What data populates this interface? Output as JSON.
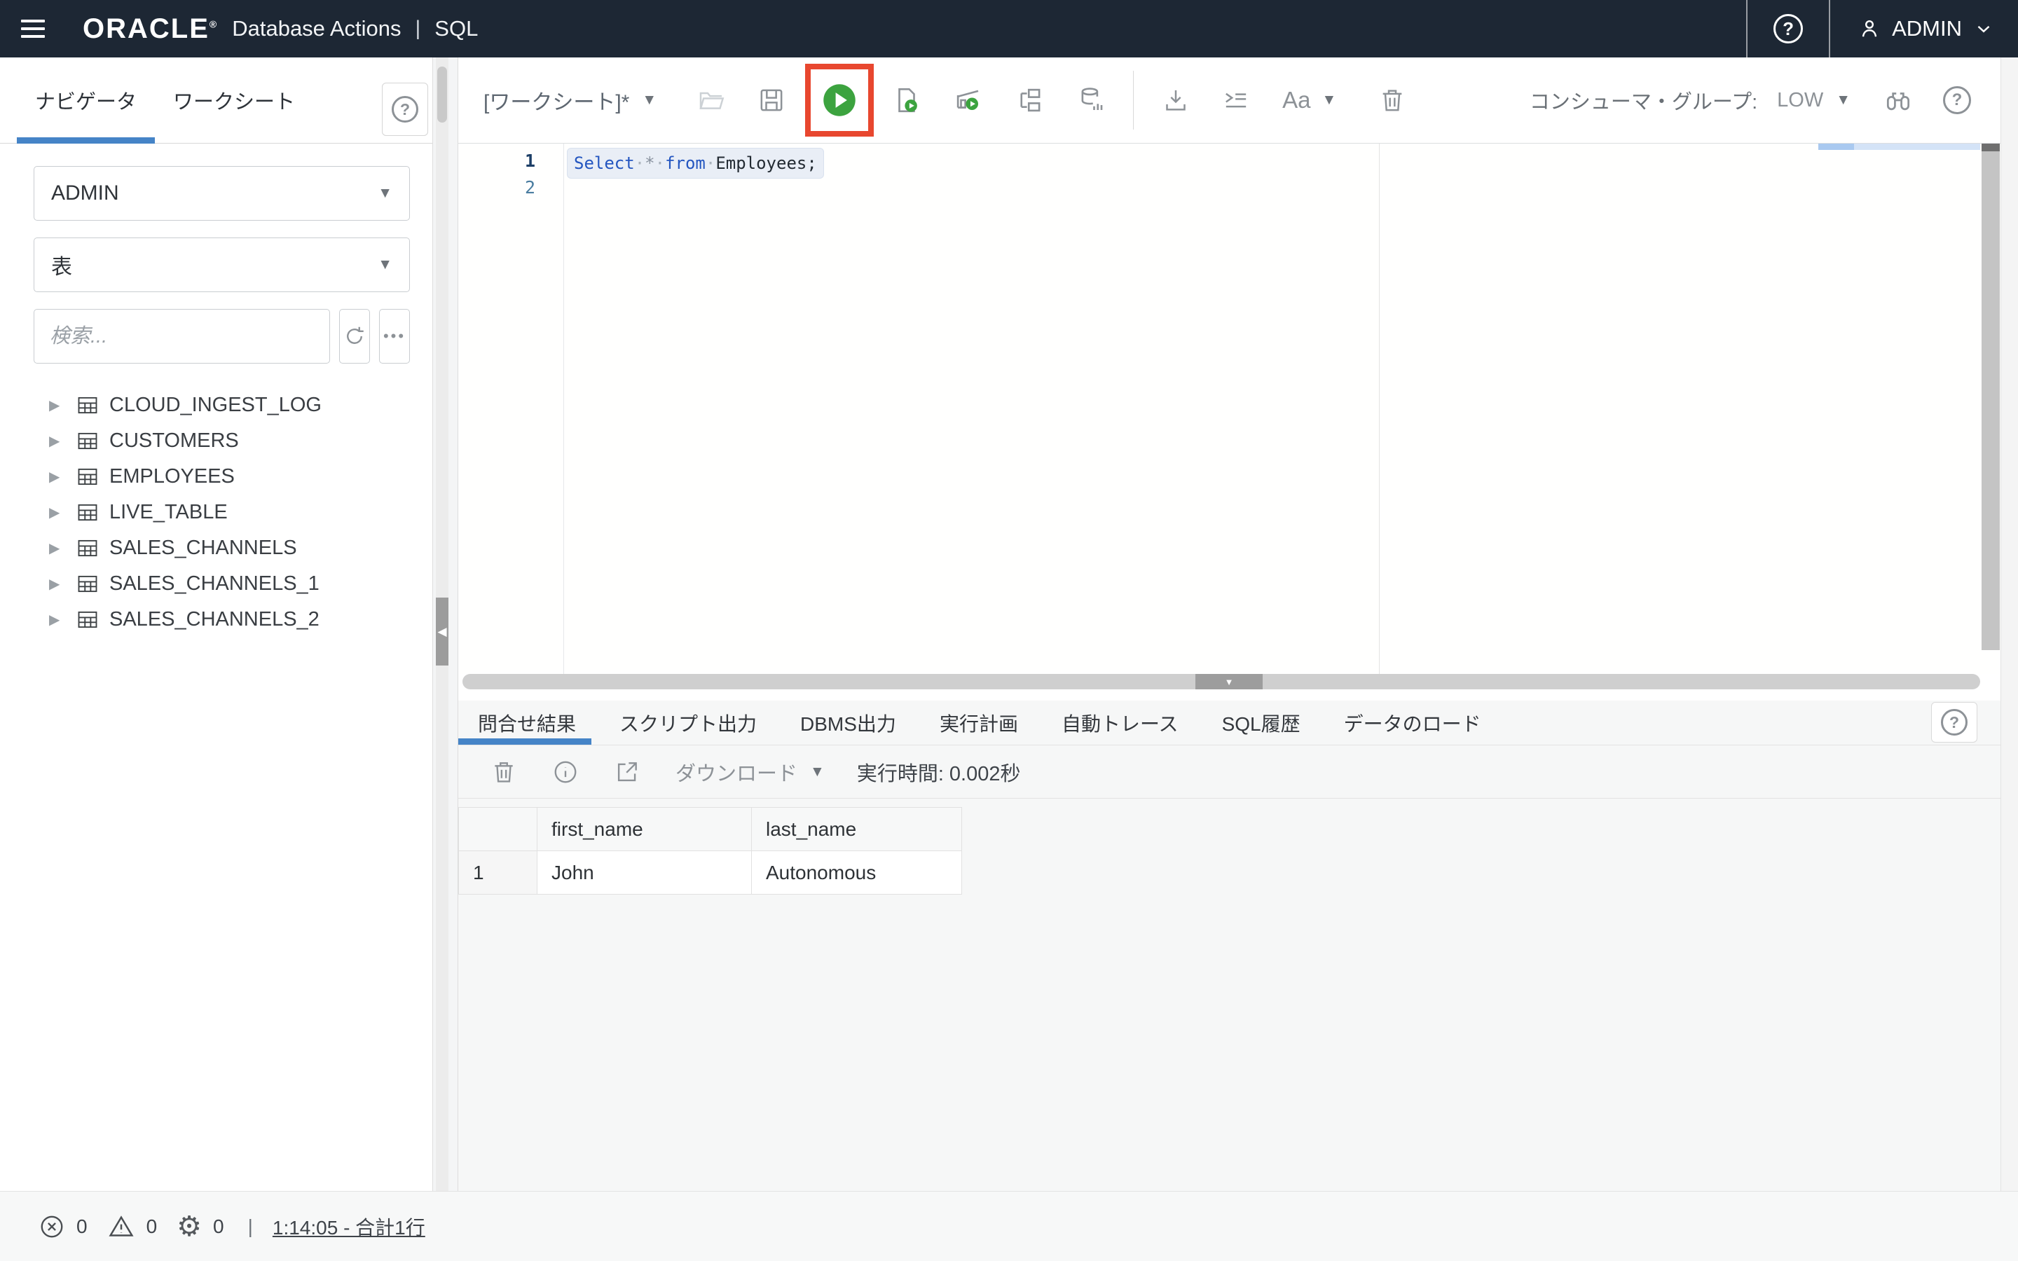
{
  "icons": {
    "question": "?",
    "dropdown_arrow": "▼",
    "tree_expand_arrow": "▶",
    "collapse_left_arrow": "◀",
    "collapse_down_arrow": "▼",
    "ellipsis": "•••",
    "gear": "⚙",
    "whitespace_dot": "·"
  },
  "colors": {
    "header_bg": "#1d2734",
    "accent_blue": "#4584c7",
    "run_green": "#3ca33f",
    "annotation_red": "#e8472f"
  },
  "header": {
    "brand": "ORACLE",
    "brand_reg": "®",
    "app_title": "Database Actions",
    "divider": "|",
    "product": "SQL",
    "user_label": "ADMIN"
  },
  "sidebar": {
    "tabs": [
      "ナビゲータ",
      "ワークシート"
    ],
    "schema_select_value": "ADMIN",
    "object_type_select_value": "表",
    "search_placeholder": "検索...",
    "tables": [
      "CLOUD_INGEST_LOG",
      "CUSTOMERS",
      "EMPLOYEES",
      "LIVE_TABLE",
      "SALES_CHANNELS",
      "SALES_CHANNELS_1",
      "SALES_CHANNELS_2"
    ]
  },
  "worksheet_toolbar": {
    "worksheet_label": "[ワークシート]*",
    "font_size_label": "Aa",
    "consumer_group_label": "コンシューマ・グループ:",
    "consumer_group_value": "LOW"
  },
  "editor": {
    "line_numbers": [
      "1",
      "2"
    ],
    "code_line": "Select * from Employees;",
    "tokens": {
      "kw1": "Select",
      "star": "*",
      "kw2": "from",
      "ident": "Employees;"
    }
  },
  "results": {
    "tabs": [
      "問合せ結果",
      "スクリプト出力",
      "DBMS出力",
      "実行計画",
      "自動トレース",
      "SQL履歴",
      "データのロード"
    ],
    "active_tab": "問合せ結果",
    "download_label": "ダウンロード",
    "execution_time": "実行時間: 0.002秒",
    "grid": {
      "columns": [
        "first_name",
        "last_name"
      ],
      "rows": [
        {
          "num": "1",
          "first_name": "John",
          "last_name": "Autonomous"
        }
      ]
    }
  },
  "statusbar": {
    "error_count": "0",
    "warning_count": "0",
    "task_count": "0",
    "separator": "|",
    "session_summary": "1:14:05 - 合計1行"
  }
}
